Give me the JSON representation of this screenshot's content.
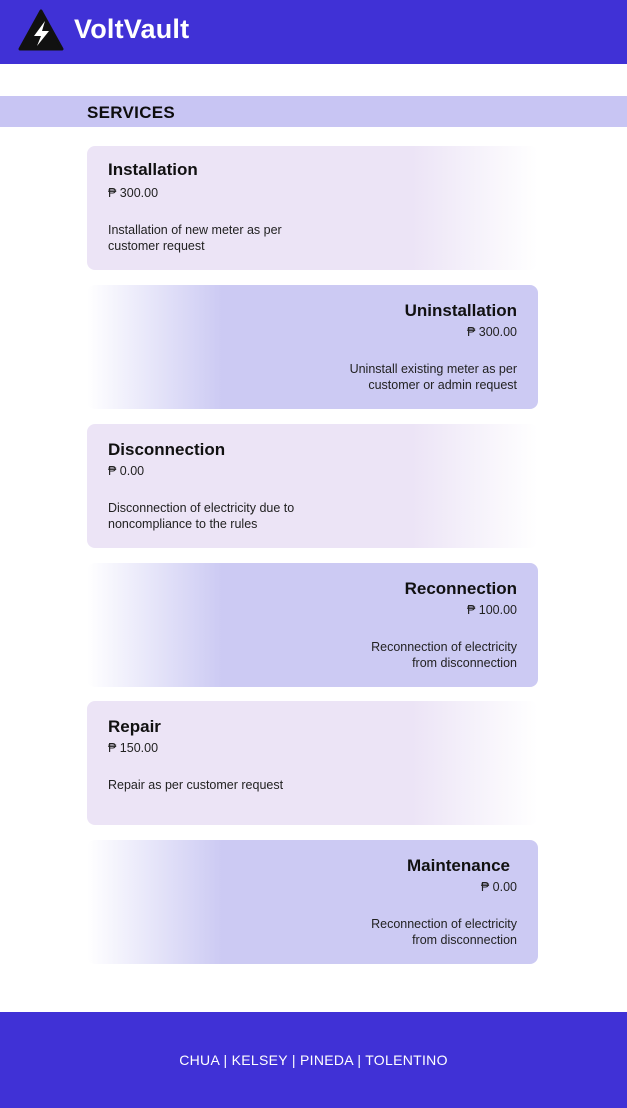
{
  "header": {
    "brand": "VoltVault",
    "logo_icon": "lightning-triangle-icon",
    "background": "#4031d6"
  },
  "section": {
    "title": "SERVICES"
  },
  "services": [
    {
      "title": "Installation",
      "price": "₱ 300.00",
      "description": "Installation of new meter as per customer request"
    },
    {
      "title": "Uninstallation",
      "price": "₱ 300.00",
      "description": "Uninstall existing meter as per customer or admin request"
    },
    {
      "title": "Disconnection",
      "price": "₱ 0.00",
      "description": "Disconnection of electricity due to noncompliance to the rules"
    },
    {
      "title": "Reconnection",
      "price": "₱ 100.00",
      "description": "Reconnection of electricity from disconnection"
    },
    {
      "title": "Repair",
      "price": "₱ 150.00",
      "description": "Repair as per customer request"
    },
    {
      "title": "Maintenance",
      "price": "₱ 0.00",
      "description": "Reconnection of electricity from disconnection"
    }
  ],
  "footer": {
    "names": "CHUA | KELSEY | PINEDA | TOLENTINO"
  },
  "colors": {
    "accent": "#4031d6",
    "section_bar": "#c8c5f3",
    "card_light": "#ece4f6",
    "card_dark": "#cccaf3"
  }
}
